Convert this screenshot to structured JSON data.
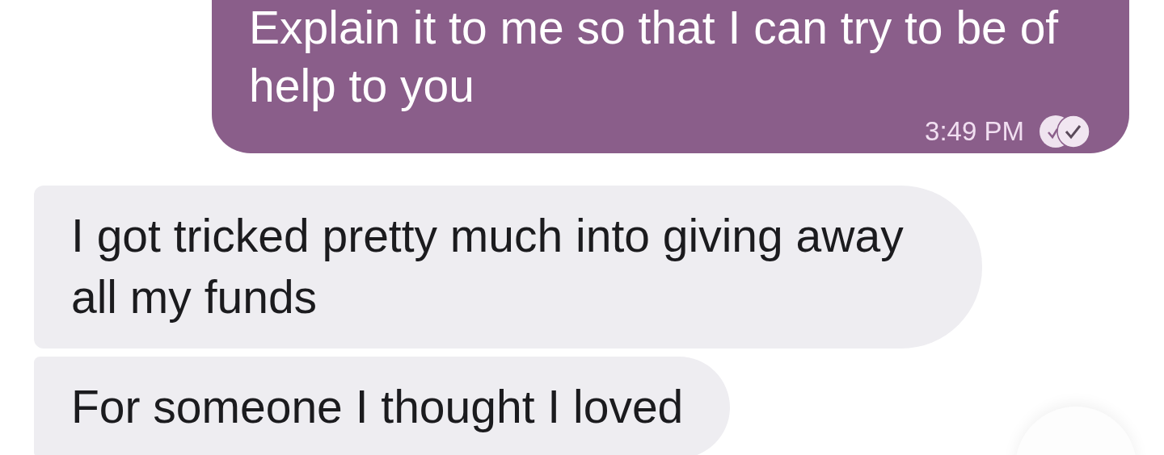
{
  "messages": [
    {
      "kind": "outgoing",
      "text": "Explain it to me so that I can try to be of help to you",
      "time": "3:49 PM",
      "read": true
    },
    {
      "kind": "incoming",
      "text": "I got tricked pretty much into giving away all my funds"
    },
    {
      "kind": "incoming",
      "text": "For someone I thought I loved"
    }
  ]
}
